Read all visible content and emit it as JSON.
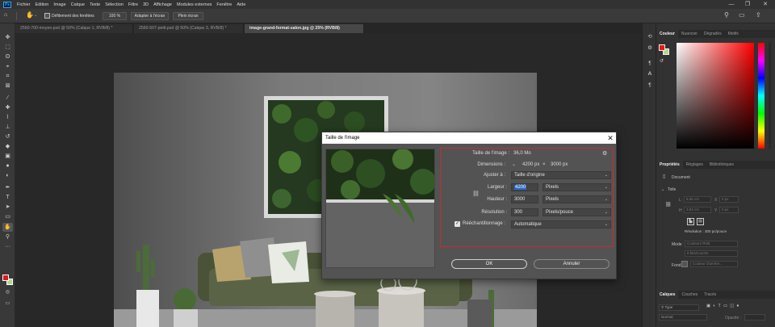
{
  "menubar": {
    "logo": "Ps",
    "items": [
      "Fichier",
      "Edition",
      "Image",
      "Calque",
      "Texte",
      "Sélection",
      "Filtre",
      "3D",
      "Affichage",
      "Modules externes",
      "Fenêtre",
      "Aide"
    ],
    "window_controls": [
      "—",
      "❐",
      "✕"
    ]
  },
  "options": {
    "scroll_all": "Défilement des fenêtres",
    "zoom_value": "100 %",
    "fit_screen": "Adapter à l'écran",
    "full_screen": "Plein écran"
  },
  "doc_tabs": [
    {
      "label": "2560-700-moyen.psd @ 50% (Calque 1, RVB/8) *",
      "active": false
    },
    {
      "label": "2560-507-petit.psd @ 50% (Calque 3, RVB/8) *",
      "active": false
    },
    {
      "label": "image-grand-format-salon.jpg @ 25% (RVB/8)",
      "active": true
    }
  ],
  "tools": [
    {
      "icon": "move-icon",
      "glyph": "✥"
    },
    {
      "icon": "marquee-icon",
      "glyph": "⬚"
    },
    {
      "icon": "lasso-icon",
      "glyph": "ʘ"
    },
    {
      "icon": "quick-select-icon",
      "glyph": "⌖"
    },
    {
      "icon": "crop-icon",
      "glyph": "⌗"
    },
    {
      "icon": "frame-icon",
      "glyph": "⊠"
    },
    {
      "icon": "eyedropper-icon",
      "glyph": "⁄"
    },
    {
      "icon": "healing-icon",
      "glyph": "✚"
    },
    {
      "icon": "brush-icon",
      "glyph": "⌇"
    },
    {
      "icon": "stamp-icon",
      "glyph": "⊥"
    },
    {
      "icon": "history-brush-icon",
      "glyph": "↺"
    },
    {
      "icon": "eraser-icon",
      "glyph": "◆"
    },
    {
      "icon": "gradient-icon",
      "glyph": "▣"
    },
    {
      "icon": "blur-icon",
      "glyph": "●"
    },
    {
      "icon": "dodge-icon",
      "glyph": "◐"
    },
    {
      "icon": "pen-icon",
      "glyph": "✒"
    },
    {
      "icon": "type-icon",
      "glyph": "T"
    },
    {
      "icon": "path-select-icon",
      "glyph": "➤"
    },
    {
      "icon": "shape-icon",
      "glyph": "▭"
    },
    {
      "icon": "hand-icon",
      "glyph": "✋"
    },
    {
      "icon": "zoom-icon",
      "glyph": "⚲"
    },
    {
      "icon": "more-tools-icon",
      "glyph": "···"
    }
  ],
  "colors": {
    "foreground": "#e31919",
    "background": "#b2d98a",
    "selection_frame": "#c62c32",
    "ok_button_border": "#c8c8c8"
  },
  "right_strip": [
    {
      "icon": "history-icon",
      "glyph": "⟲"
    },
    {
      "icon": "properties-icon",
      "glyph": "⚙"
    },
    {
      "icon": "paragraph-icon",
      "glyph": "¶"
    },
    {
      "icon": "character-icon",
      "glyph": "A"
    },
    {
      "icon": "paragraph-style-icon",
      "glyph": "¶"
    }
  ],
  "color_panel": {
    "tabs": [
      "Couleur",
      "Nuancier",
      "Dégradés",
      "Motifs"
    ],
    "active": 0
  },
  "props_panel": {
    "tabs": [
      "Propriétés",
      "Réglages",
      "Bibliothèques"
    ],
    "active": 0,
    "doc_label": "Document",
    "canvas_section": "Toile",
    "w_label": "L",
    "w_value": "8,96 cm",
    "x_label": "X",
    "x_value": "0 px",
    "h_label": "H",
    "h_value": "3,94 cm",
    "y_label": "Y",
    "y_value": "0 px",
    "resolution": "Résolution : 300 pc/pouce",
    "mode_label": "Mode",
    "mode_value": "Couleurs RVB",
    "bits_value": "8 bits/couche",
    "fond_label": "Fond",
    "fond_value": "Couleur d'arrière..."
  },
  "layers_panel": {
    "tabs": [
      "Calques",
      "Couches",
      "Tracés"
    ],
    "active": 0,
    "search_placeholder": "Type",
    "blend_mode": "Normal",
    "opacity_label": "Opacité :"
  },
  "dialog": {
    "title": "Taille de l'image",
    "image_size_label": "Taille de l'image :",
    "image_size_value": "36,0 Mo",
    "dimensions_label": "Dimensions :",
    "dim_w": "4200 px",
    "dim_x": "×",
    "dim_h": "3000 px",
    "fit_label": "Ajuster à :",
    "fit_value": "Taille d'origine",
    "width_label": "Largeur :",
    "width_value": "4200",
    "width_unit": "Pixels",
    "height_label": "Hauteur :",
    "height_value": "3000",
    "height_unit": "Pixels",
    "res_label": "Résolution :",
    "res_value": "300",
    "res_unit": "Pixels/pouce",
    "resample_label": "Rééchantillonnage :",
    "resample_value": "Automatique",
    "resample_checked": true,
    "ok": "OK",
    "cancel": "Annuler"
  }
}
